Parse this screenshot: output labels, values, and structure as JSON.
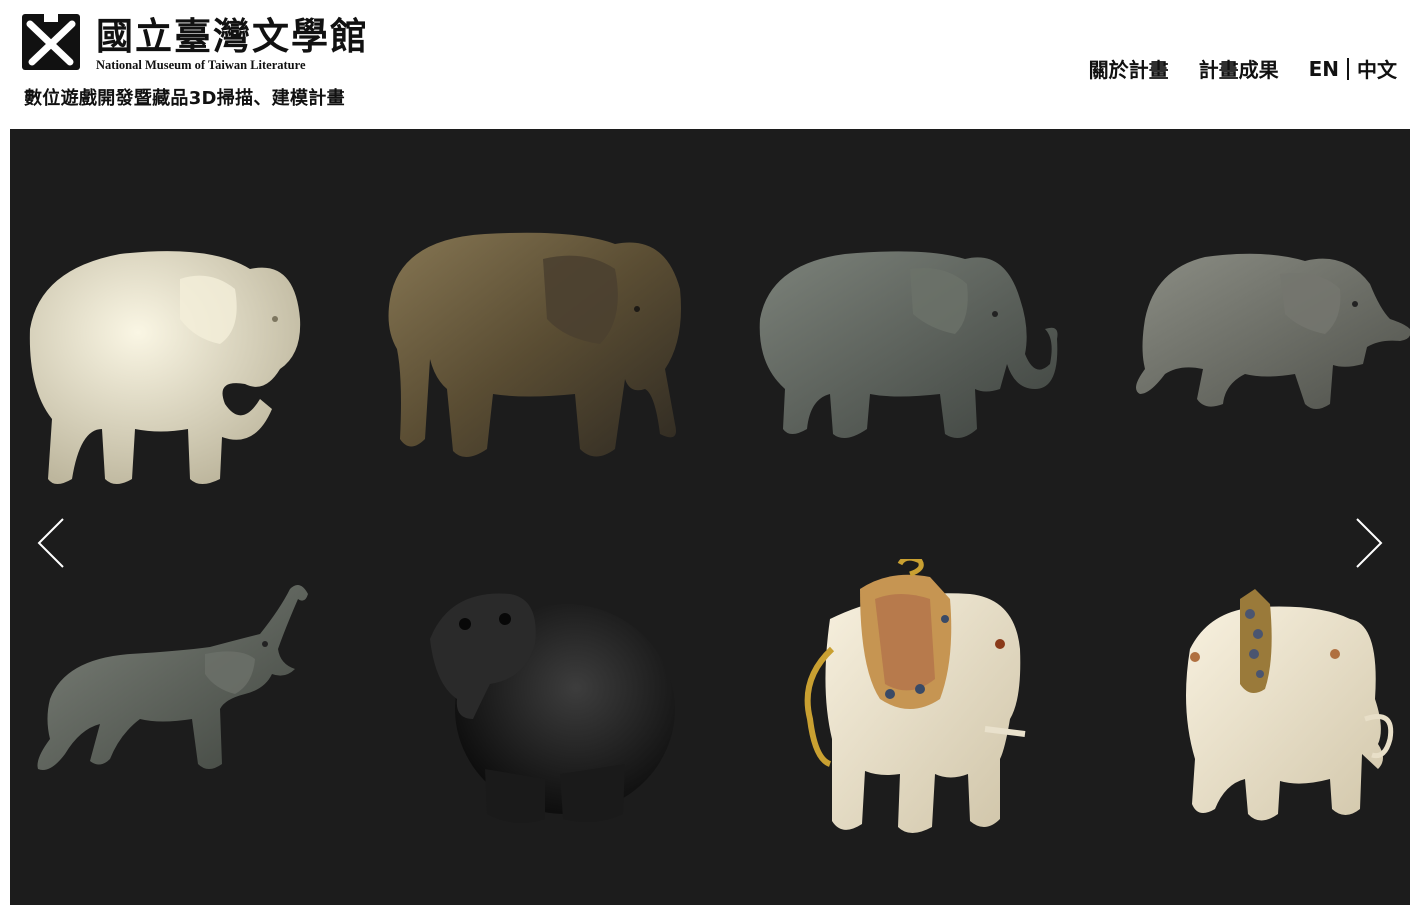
{
  "header": {
    "logo_zh": "國立臺灣文學館",
    "logo_en": "National Museum of Taiwan Literature",
    "subtitle": "數位遊戲開發暨藏品3D掃描、建模計畫"
  },
  "nav": {
    "about": "關於計畫",
    "results": "計畫成果",
    "lang_en": "EN",
    "lang_zh": "中文"
  },
  "gallery": {
    "background": "#1c1c1c",
    "items": [
      {
        "name": "white-glass-elephant",
        "color": "#e8e2cc"
      },
      {
        "name": "bronze-elephant",
        "color": "#5d5035"
      },
      {
        "name": "grey-glass-elephant",
        "color": "#565c56"
      },
      {
        "name": "grey-walking-elephant",
        "color": "#6d6f66"
      },
      {
        "name": "trunk-raised-elephant",
        "color": "#5f645e"
      },
      {
        "name": "black-round-elephant",
        "color": "#232323"
      },
      {
        "name": "ivory-gold-pendant-elephant",
        "color": "#ede4d0"
      },
      {
        "name": "ivory-jeweled-elephant",
        "color": "#efe6d2"
      }
    ],
    "prev_icon": "chevron-left-icon",
    "next_icon": "chevron-right-icon"
  }
}
